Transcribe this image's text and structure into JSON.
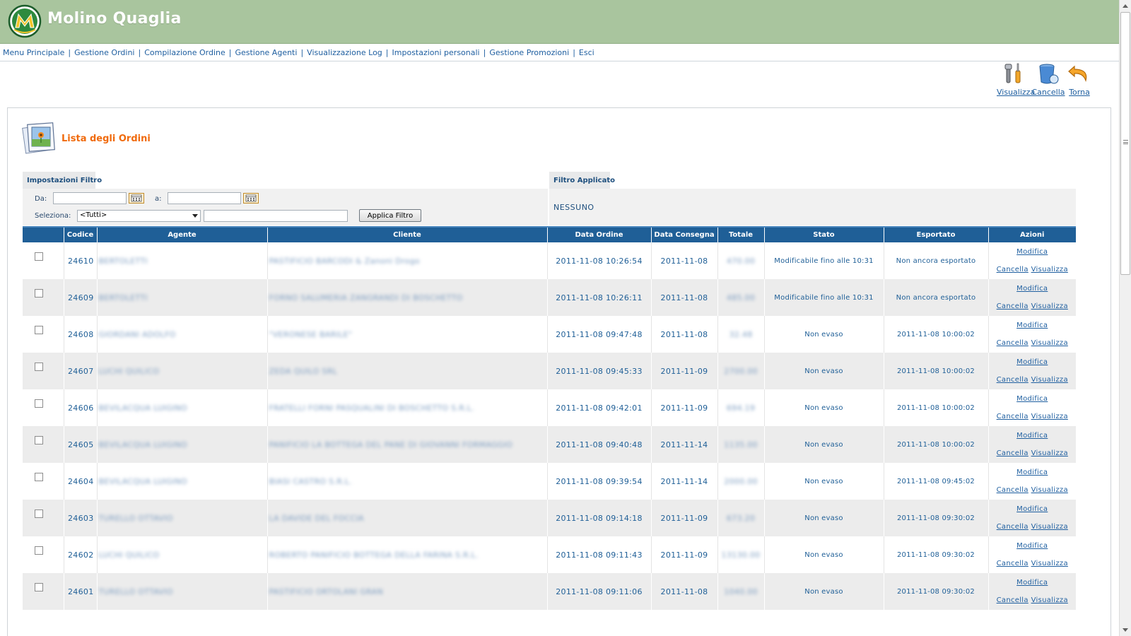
{
  "brand": {
    "title": "Molino Quaglia"
  },
  "nav": {
    "items": [
      "Menu Principale",
      "Gestione Ordini",
      "Compilazione Ordine",
      "Gestione Agenti",
      "Visualizzazione Log",
      "Impostazioni personali",
      "Gestione Promozioni",
      "Esci"
    ],
    "separator": "|"
  },
  "toolbar": {
    "view_label": "Visualizza",
    "delete_label": "Cancella",
    "back_label": "Torna"
  },
  "page": {
    "title": "Lista degli Ordini"
  },
  "filter": {
    "settings_tab": "Impostazioni Filtro",
    "from_label": "Da:",
    "from_value": "",
    "to_label": "a:",
    "to_value": "",
    "select_label": "Seleziona:",
    "select_value": "<Tutti>",
    "search_value": "",
    "apply_label": "Applica Filtro",
    "applied_tab": "Filtro Applicato",
    "applied_value": "NESSUNO"
  },
  "table": {
    "headers": [
      "",
      "Codice",
      "Agente",
      "Cliente",
      "Data Ordine",
      "Data Consegna",
      "Totale",
      "Stato",
      "Esportato",
      "Azioni"
    ],
    "action_labels": {
      "edit": "Modifica",
      "delete": "Cancella",
      "view": "Visualizza"
    },
    "rows": [
      {
        "code": "24610",
        "agent": "BERTOLETTI",
        "client": "PASTIFICIO BARCODI & Zanoni Drogo",
        "order_date": "2011-11-08 10:26:54",
        "delivery_date": "2011-11-08",
        "total": "470.00",
        "status": "Modificabile fino alle 10:31",
        "exported": "Non ancora esportato"
      },
      {
        "code": "24609",
        "agent": "BERTOLETTI",
        "client": "FORNO SALUMERIA ZANGRANDI DI BOSCHETTO",
        "order_date": "2011-11-08 10:26:11",
        "delivery_date": "2011-11-08",
        "total": "485.00",
        "status": "Modificabile fino alle 10:31",
        "exported": "Non ancora esportato"
      },
      {
        "code": "24608",
        "agent": "GIORDANI ADOLFO",
        "client": "\"VERONESE BARILE\"",
        "order_date": "2011-11-08 09:47:48",
        "delivery_date": "2011-11-08",
        "total": "32.48",
        "status": "Non evaso",
        "exported": "2011-11-08 10:00:02"
      },
      {
        "code": "24607",
        "agent": "LUCHI QUILICO",
        "client": "ZEDA QUILO SRL",
        "order_date": "2011-11-08 09:45:33",
        "delivery_date": "2011-11-09",
        "total": "2700.00",
        "status": "Non evaso",
        "exported": "2011-11-08 10:00:02"
      },
      {
        "code": "24606",
        "agent": "BEVILACQUA LUIGINO",
        "client": "FRATELLI FORNI PASQUALINI DI BOSCHETTO S.R.L.",
        "order_date": "2011-11-08 09:42:01",
        "delivery_date": "2011-11-09",
        "total": "694.19",
        "status": "Non evaso",
        "exported": "2011-11-08 10:00:02"
      },
      {
        "code": "24605",
        "agent": "BEVILACQUA LUIGINO",
        "client": "PANIFICIO LA BOTTEGA DEL PANE DI GIOVANNI FORMAGGIO",
        "order_date": "2011-11-08 09:40:48",
        "delivery_date": "2011-11-14",
        "total": "1135.00",
        "status": "Non evaso",
        "exported": "2011-11-08 10:00:02"
      },
      {
        "code": "24604",
        "agent": "BEVILACQUA LUIGINO",
        "client": "BIASI CASTRO S.R.L.",
        "order_date": "2011-11-08 09:39:54",
        "delivery_date": "2011-11-14",
        "total": "2000.00",
        "status": "Non evaso",
        "exported": "2011-11-08 09:45:02"
      },
      {
        "code": "24603",
        "agent": "TURELLO OTTAVIO",
        "client": "LA DAVIDE DEL FOCCIA",
        "order_date": "2011-11-08 09:14:18",
        "delivery_date": "2011-11-09",
        "total": "673.20",
        "status": "Non evaso",
        "exported": "2011-11-08 09:30:02"
      },
      {
        "code": "24602",
        "agent": "LUCHI QUILICO",
        "client": "ROBERTO PANIFICIO BOTTEGA DELLA FARINA S.R.L.",
        "order_date": "2011-11-08 09:11:43",
        "delivery_date": "2011-11-09",
        "total": "13130.00",
        "status": "Non evaso",
        "exported": "2011-11-08 09:30:02"
      },
      {
        "code": "24601",
        "agent": "TURELLO OTTAVIO",
        "client": "PASTIFICIO ORTOLANI GRAN",
        "order_date": "2011-11-08 09:11:06",
        "delivery_date": "2011-11-08",
        "total": "1040.00",
        "status": "Non evaso",
        "exported": "2011-11-08 09:30:02"
      }
    ]
  },
  "colors": {
    "header_bg": "#a9c59e",
    "accent_orange": "#f06a0c",
    "table_header": "#1f5f97",
    "link": "#1f5fa0"
  },
  "icons": {
    "logo": "molino-quaglia-logo",
    "view": "tools-icon",
    "delete": "trash-bin-icon",
    "back": "undo-arrow-icon",
    "list": "photo-document-icon",
    "calendar": "calendar-icon"
  }
}
